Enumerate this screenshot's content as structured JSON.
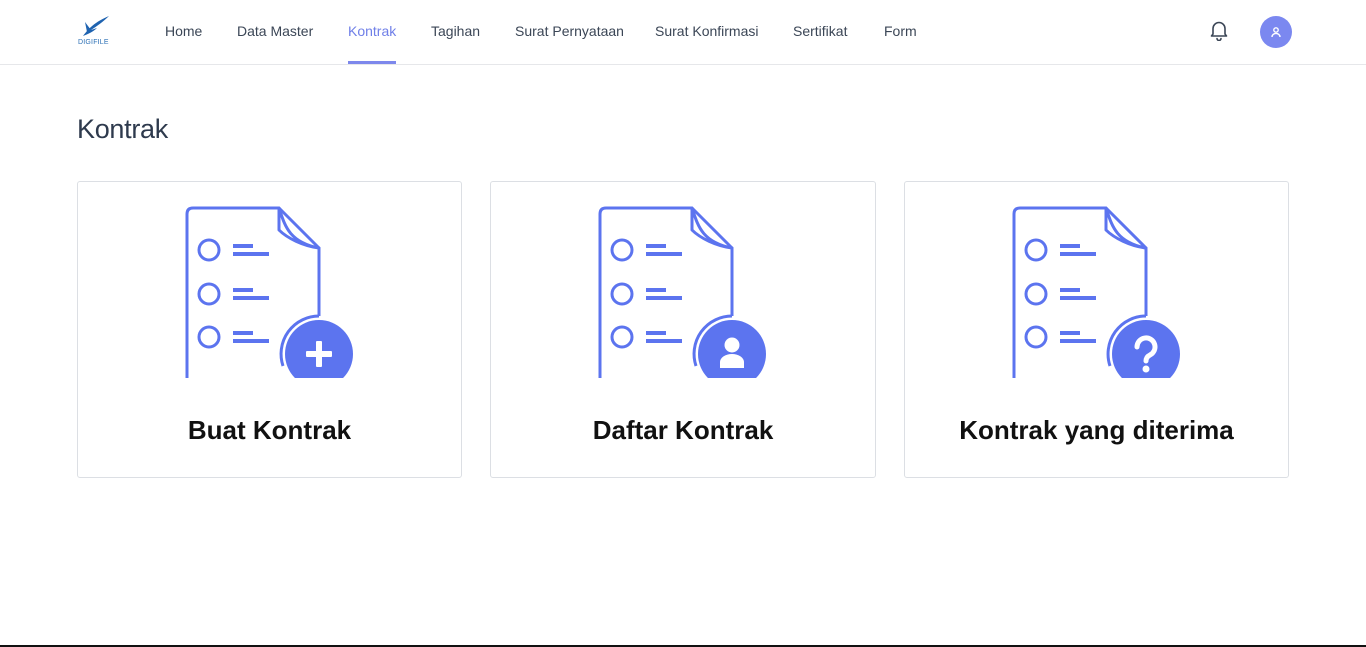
{
  "brand": {
    "logo_text": "DIGIFILE"
  },
  "nav": {
    "items": [
      {
        "label": "Home"
      },
      {
        "label": "Data Master"
      },
      {
        "label": "Kontrak",
        "active": true
      },
      {
        "label": "Tagihan"
      },
      {
        "label": "Surat Pernyataan"
      },
      {
        "label": "Surat Konfirmasi"
      },
      {
        "label": "Sertifikat"
      },
      {
        "label": "Form"
      }
    ]
  },
  "header": {
    "notification_icon": "bell-icon",
    "avatar_icon": "user-icon"
  },
  "main": {
    "title": "Kontrak",
    "cards": [
      {
        "label": "Buat Kontrak",
        "icon": "document-plus-icon"
      },
      {
        "label": "Daftar Kontrak",
        "icon": "document-user-icon"
      },
      {
        "label": "Kontrak yang diterima",
        "icon": "document-question-icon"
      }
    ]
  },
  "colors": {
    "accent": "#6f7fe8",
    "illustration": "#5c74ef",
    "text": "#3b4656",
    "heading": "#2e3a4d"
  }
}
